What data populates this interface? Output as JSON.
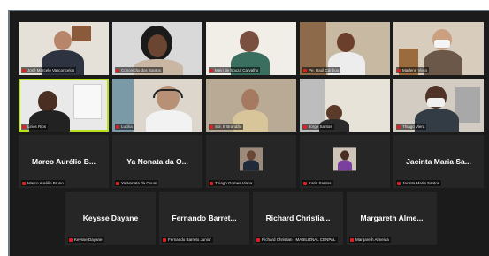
{
  "meeting": {
    "participants": [
      {
        "id": "p1",
        "label": "José Marcelo Vasconcelos",
        "muted": true
      },
      {
        "id": "p2",
        "label": "Conceição dos Santos",
        "muted": true
      },
      {
        "id": "p3",
        "label": "Meiri de Souza Carvalho",
        "muted": true
      },
      {
        "id": "p4",
        "label": "Pe. Raúl Cárdigo",
        "muted": true
      },
      {
        "id": "p5",
        "label": "Marlene Viera",
        "muted": true
      },
      {
        "id": "p6",
        "label": "Lirios Rios",
        "muted": true
      },
      {
        "id": "p7",
        "label": "Lucilia",
        "muted": true
      },
      {
        "id": "p8",
        "label": "Sol. E Brandão",
        "muted": true
      },
      {
        "id": "p9",
        "label": "Jorge Santos",
        "muted": true
      },
      {
        "id": "p10",
        "label": "Thiago Viera",
        "muted": true
      },
      {
        "id": "p11",
        "display_name": "Marco Aurélio B...",
        "label": "Marco Aurélio Bruno",
        "muted": true
      },
      {
        "id": "p12",
        "display_name": "Ya Nonata da O...",
        "label": "Ya Nonata da Oxum",
        "muted": true
      },
      {
        "id": "p13",
        "label": "Thiago Gomes Viana",
        "muted": true
      },
      {
        "id": "p14",
        "label": "Katia Santos",
        "muted": true
      },
      {
        "id": "p15",
        "display_name": "Jacinta Maria Sa...",
        "label": "Jacinta Maria Santos",
        "muted": true
      },
      {
        "id": "p16",
        "display_name": "Keysse Dayane",
        "label": "Keysse Dayane",
        "muted": true
      },
      {
        "id": "p17",
        "display_name": "Fernando Barret...",
        "label": "Fernando Barreto Junior",
        "muted": true
      },
      {
        "id": "p18",
        "display_name": "Richard Christia...",
        "label": "Richard Christian - MABILIZNAL CENPAL",
        "muted": true
      },
      {
        "id": "p19",
        "display_name": "Margareth Alme...",
        "label": "Margareth Almeida",
        "muted": true
      }
    ]
  },
  "colors": {
    "gallery_bg": "#1b1b1b",
    "tile_bg": "#262626",
    "active_speaker": "#b6e11b",
    "muted_icon": "#e02020"
  }
}
